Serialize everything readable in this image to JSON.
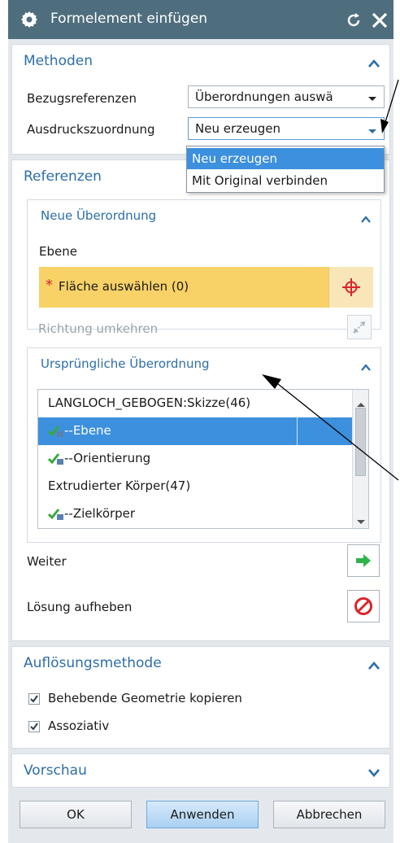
{
  "dialog": {
    "title": "Formelement einfügen"
  },
  "methoden": {
    "title": "Methoden",
    "bezug_label": "Bezugsreferenzen",
    "bezug_value": "Überordnungen auswä",
    "ausdruck_label": "Ausdruckszuordnung",
    "ausdruck_value": "Neu erzeugen",
    "dropdown_options": [
      "Neu erzeugen",
      "Mit Original verbinden"
    ]
  },
  "referenzen": {
    "title": "Referenzen",
    "neue": {
      "title": "Neue Überordnung",
      "ebene_label": "Ebene",
      "flaeche_label": "Fläche auswählen (0)",
      "required_mark": "*",
      "richtung_label": "Richtung umkehren"
    },
    "urspruengliche": {
      "title": "Ursprüngliche Überordnung",
      "rows": [
        {
          "text": "LANGLOCH_GEBOGEN:Skizze(46)"
        },
        {
          "text": "--Ebene"
        },
        {
          "text": "--Orientierung"
        },
        {
          "text": "Extrudierter Körper(47)"
        },
        {
          "text": "--Zielkörper"
        }
      ]
    },
    "weiter_label": "Weiter",
    "loesung_label": "Lösung aufheben"
  },
  "aufloesung": {
    "title": "Auflösungsmethode",
    "opt1_label": "Behebende Geometrie kopieren",
    "opt1_checked": true,
    "opt2_label": "Assoziativ",
    "opt2_checked": true
  },
  "vorschau": {
    "title": "Vorschau"
  },
  "buttons": {
    "ok": "OK",
    "apply": "Anwenden",
    "cancel": "Abbrechen"
  },
  "colors": {
    "titlebar": "#4f6e7d",
    "accent": "#2d6ea8",
    "selection": "#3c90dd",
    "required_highlight": "#f8d267",
    "required_star": "#d9262b",
    "next_arrow": "#2fb34a",
    "cancel_red": "#d8262a"
  }
}
